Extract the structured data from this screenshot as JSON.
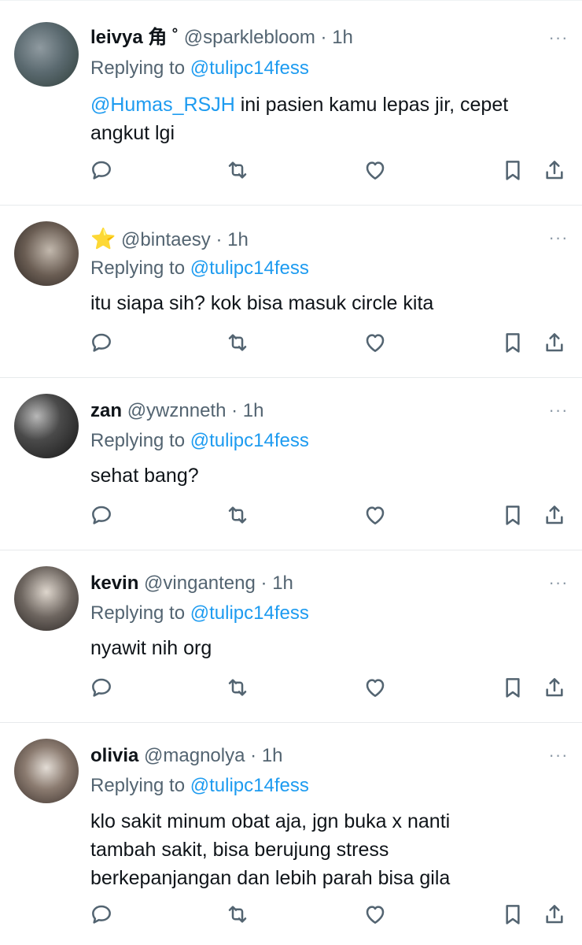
{
  "replying_label": "Replying to",
  "replies": [
    {
      "name": "leivya ⻆ ˚",
      "handle": "@sparklebloom",
      "sep": "·",
      "time": "1h",
      "reply_to": "@tulipc14fess",
      "mention": "@Humas_RSJH",
      "text": "ini pasien kamu lepas jir, cepet angkut lgi"
    },
    {
      "name": "⭐",
      "handle": "@bintaesy",
      "sep": "·",
      "time": "1h",
      "reply_to": "@tulipc14fess",
      "text": "itu siapa sih? kok bisa masuk circle kita"
    },
    {
      "name": "zan",
      "handle": "@ywznneth",
      "sep": "·",
      "time": "1h",
      "reply_to": "@tulipc14fess",
      "text": "sehat bang?"
    },
    {
      "name": "kevin",
      "handle": "@vinganteng",
      "sep": "·",
      "time": "1h",
      "reply_to": "@tulipc14fess",
      "text": "nyawit nih org"
    },
    {
      "name": "olivia",
      "handle": "@magnolya",
      "sep": "·",
      "time": "1h",
      "reply_to": "@tulipc14fess",
      "text": "klo sakit minum obat aja, jgn buka x nanti tambah sakit, bisa berujung stress berkepanjangan dan lebih parah bisa gila"
    }
  ],
  "more_glyph": "···",
  "icons": [
    "reply-icon",
    "retweet-icon",
    "like-icon",
    "bookmark-icon",
    "share-icon"
  ],
  "colors": {
    "link": "#1d9bf0",
    "muted": "#536471",
    "text": "#0f1419"
  }
}
